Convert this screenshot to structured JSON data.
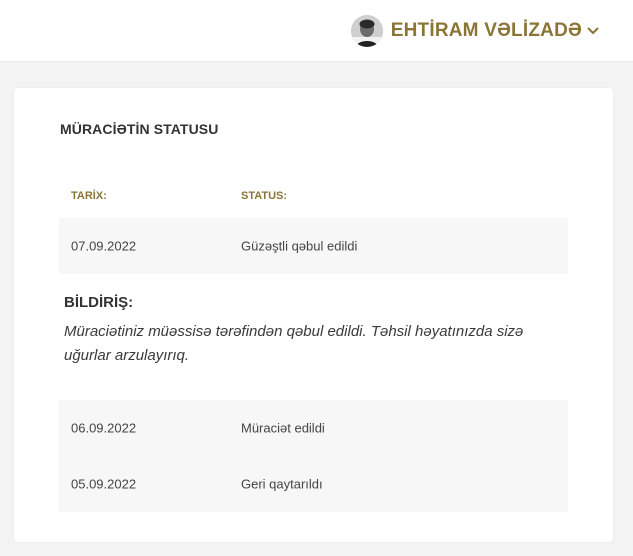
{
  "header": {
    "user_name": "EHTİRAM VƏLİZADƏ",
    "icons": {
      "avatar": "user-avatar",
      "dropdown": "chevron-down-icon"
    },
    "accent_color": "#8a7536"
  },
  "status_card": {
    "title": "MÜRACİƏTİN STATUSU",
    "columns": {
      "date": "TARİX:",
      "status": "STATUS:"
    },
    "current": {
      "date": "07.09.2022",
      "status": "Güzəştli qəbul edildi"
    },
    "notice": {
      "title": "BİLDİRİŞ:",
      "text": "Müraciətiniz müəssisə tərəfindən qəbul edildi. Təhsil həyatınızda sizə uğurlar arzulayırıq."
    },
    "history": [
      {
        "date": "06.09.2022",
        "status": "Müraciət edildi"
      },
      {
        "date": "05.09.2022",
        "status": "Geri qaytarıldı"
      }
    ]
  }
}
